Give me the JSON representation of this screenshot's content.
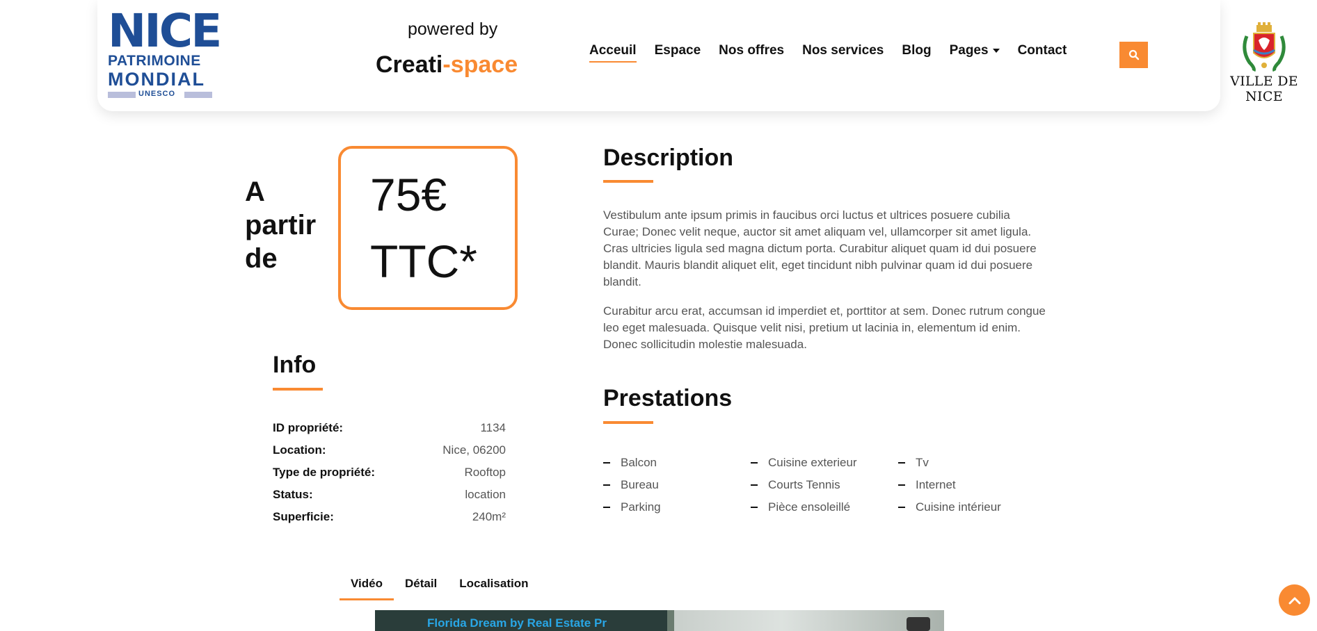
{
  "header": {
    "logo_nice": {
      "big": "NICE",
      "line1": "PATRIMOINE",
      "line2": "MONDIAL",
      "line3": "UNESCO"
    },
    "powered_by": "powered by",
    "brand_main": "Creati",
    "brand_accent": "-space",
    "nav": [
      {
        "label": "Acceuil",
        "active": true
      },
      {
        "label": "Espace"
      },
      {
        "label": "Nos offres"
      },
      {
        "label": "Nos services"
      },
      {
        "label": "Blog"
      },
      {
        "label": "Pages",
        "dropdown": true
      },
      {
        "label": "Contact"
      }
    ],
    "search_icon": "search-icon",
    "logo_ville": "VILLE DE NICE"
  },
  "price": {
    "prefix_line1": "A",
    "prefix_line2": "partir",
    "prefix_line3": "de",
    "amount": "75€",
    "suffix": "TTC*"
  },
  "info": {
    "title": "Info",
    "rows": [
      {
        "label": "ID propriété:",
        "value": "1134"
      },
      {
        "label": "Location:",
        "value": "Nice, 06200"
      },
      {
        "label": "Type de propriété:",
        "value": "Rooftop"
      },
      {
        "label": "Status:",
        "value": "location"
      },
      {
        "label": "Superficie:",
        "value": "240m²"
      }
    ]
  },
  "description": {
    "title": "Description",
    "p1": "Vestibulum ante ipsum primis in faucibus orci luctus et ultrices posuere cubilia Curae; Donec velit neque, auctor sit amet aliquam vel, ullamcorper sit amet ligula. Cras ultricies ligula sed magna dictum porta. Curabitur aliquet quam id dui posuere blandit. Mauris blandit aliquet elit, eget tincidunt nibh pulvinar quam id dui posuere blandit.",
    "p2": "Curabitur arcu erat, accumsan id imperdiet et, porttitor at sem. Donec rutrum congue leo eget malesuada. Quisque velit nisi, pretium ut lacinia in, elementum id enim. Donec sollicitudin molestie malesuada."
  },
  "prestations": {
    "title": "Prestations",
    "items": [
      "Balcon",
      "Cuisine exterieur",
      "Tv",
      "Bureau",
      "Courts Tennis",
      "Internet",
      "Parking",
      "Pièce ensoleillé",
      "Cuisine intérieur"
    ]
  },
  "tabs": [
    {
      "label": "Vidéo",
      "active": true
    },
    {
      "label": "Détail"
    },
    {
      "label": "Localisation"
    }
  ],
  "video": {
    "caption": "Florida Dream by Real Estate Pr"
  },
  "colors": {
    "accent": "#f98a32",
    "nice_blue": "#1f4e96"
  }
}
